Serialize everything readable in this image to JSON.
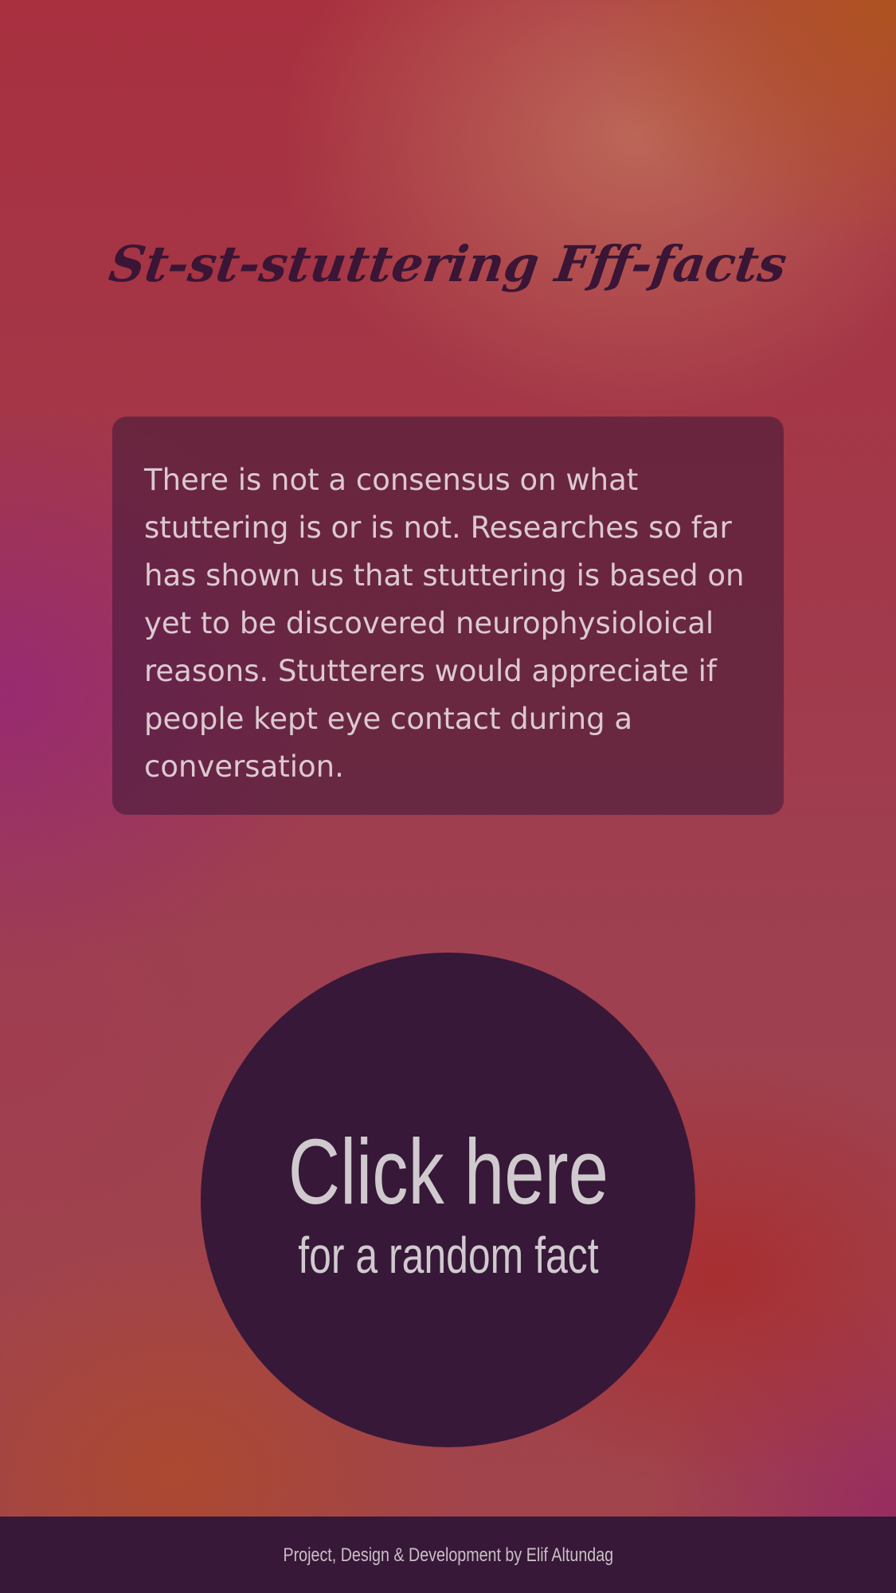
{
  "header": {
    "title": "St-st-stuttering Fff-facts"
  },
  "fact": {
    "text": "There is not a consensus on what stuttering is or is not. Researches so far has shown us that stuttering is based on yet to be discovered neurophysioloical reasons. Stutterers would appreciate if people kept eye contact during a conversation."
  },
  "cta": {
    "main_label": "Click here",
    "sub_label": "for a random fact"
  },
  "footer": {
    "credit": "Project, Design & Development by Elif Altundag"
  },
  "colors": {
    "title": "#3a1535",
    "circle": "#371838",
    "footer_bg": "#371838",
    "text_light": "#d0cacf"
  }
}
